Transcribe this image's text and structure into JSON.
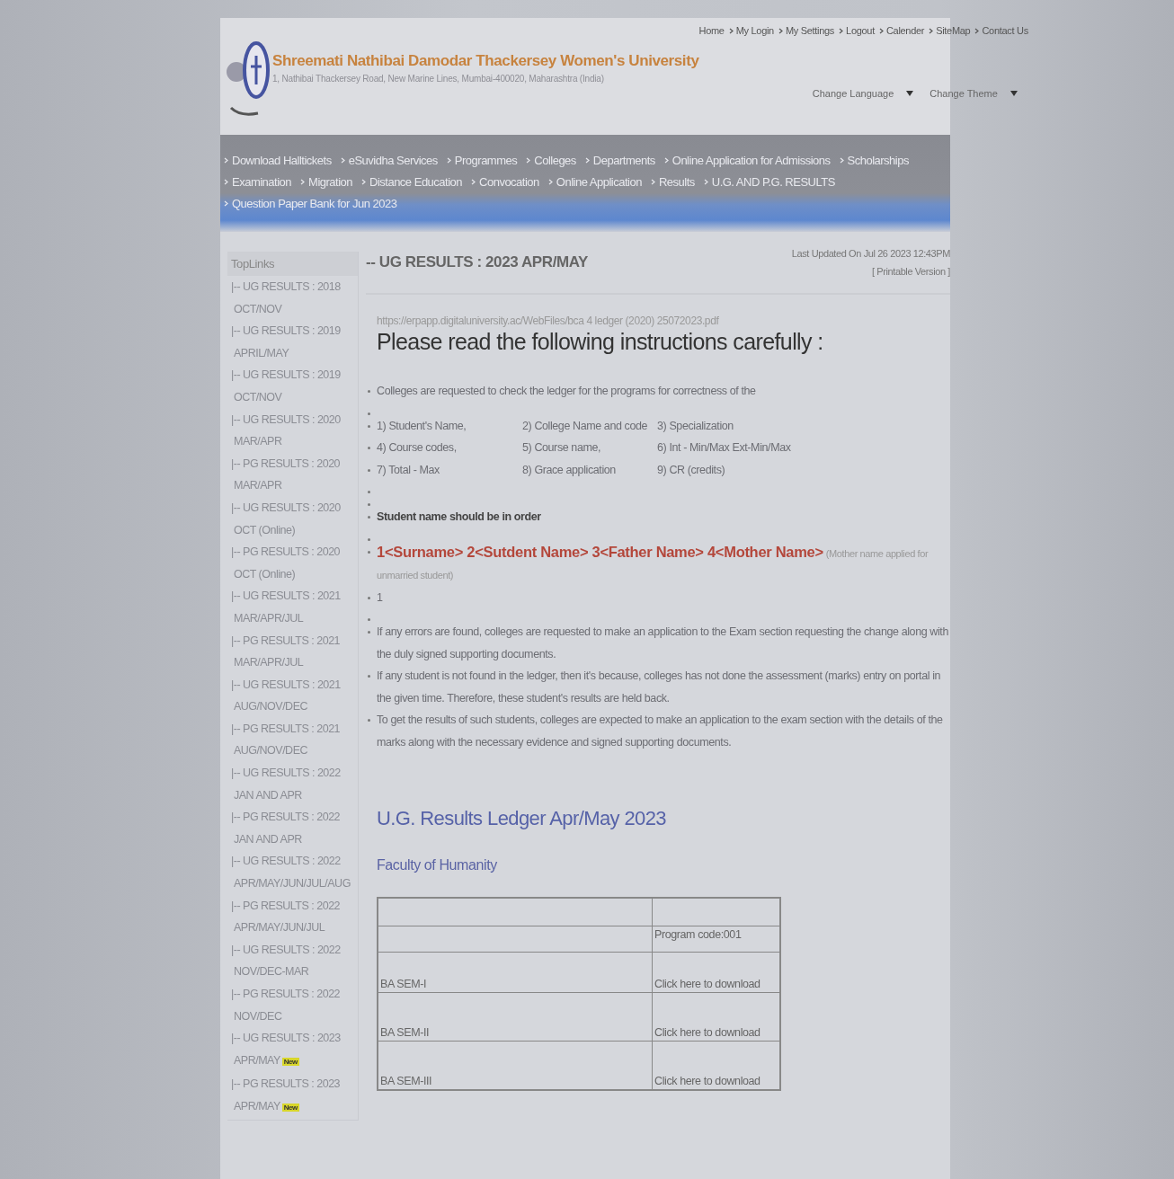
{
  "header": {
    "university_name": "Shreemati Nathibai Damodar Thackersey Women's University",
    "address": "1, Nathibai Thackersey Road, New Marine Lines, Mumbai-400020, Maharashtra (India)",
    "top_links": [
      "Home",
      "My Login",
      "My Settings",
      "Logout",
      "Calender",
      "SiteMap",
      "Contact Us"
    ],
    "selects": [
      "Change Language",
      "Change Theme"
    ]
  },
  "main_menu": [
    "Download Halltickets",
    "eSuvidha Services",
    "Programmes",
    "Colleges",
    "Departments",
    "Online Application for Admissions",
    "Scholarships",
    "Examination",
    "Migration",
    "Distance Education",
    "Convocation",
    "Online Application",
    "Results",
    "U.G. AND P.G. RESULTS",
    "Question Paper Bank for Jun 2023"
  ],
  "sidebar": {
    "title": "TopLinks",
    "items": [
      {
        "title": "|-- UG RESULTS : 2018",
        "period": "OCT/NOV"
      },
      {
        "title": "|-- UG RESULTS : 2019",
        "period": "APRIL/MAY"
      },
      {
        "title": "|-- UG RESULTS : 2019",
        "period": "OCT/NOV"
      },
      {
        "title": "|-- UG RESULTS : 2020",
        "period": "MAR/APR"
      },
      {
        "title": "|-- PG RESULTS : 2020",
        "period": "MAR/APR"
      },
      {
        "title": "|-- UG RESULTS : 2020",
        "period": "OCT (Online)"
      },
      {
        "title": "|-- PG RESULTS : 2020",
        "period": "OCT (Online)"
      },
      {
        "title": "|-- UG RESULTS : 2021",
        "period": "MAR/APR/JUL"
      },
      {
        "title": "|-- PG RESULTS : 2021",
        "period": "MAR/APR/JUL"
      },
      {
        "title": "|-- UG RESULTS : 2021",
        "period": "AUG/NOV/DEC"
      },
      {
        "title": "|-- PG RESULTS : 2021",
        "period": "AUG/NOV/DEC"
      },
      {
        "title": "|-- UG RESULTS : 2022",
        "period": "JAN AND APR"
      },
      {
        "title": "|-- PG RESULTS : 2022",
        "period": "JAN AND APR"
      },
      {
        "title": "|-- UG RESULTS : 2022",
        "period": "APR/MAY/JUN/JUL/AUG"
      },
      {
        "title": "|-- PG RESULTS : 2022",
        "period": "APR/MAY/JUN/JUL"
      },
      {
        "title": "|-- UG RESULTS : 2022",
        "period": "NOV/DEC-MAR"
      },
      {
        "title": "|-- PG RESULTS : 2022",
        "period": "NOV/DEC"
      },
      {
        "title": "|-- UG RESULTS : 2023",
        "period": "APR/MAY",
        "badge": "New"
      },
      {
        "title": "|-- PG RESULTS : 2023",
        "period": "APR/MAY",
        "badge": "New"
      }
    ]
  },
  "content": {
    "title": "-- UG RESULTS : 2023 APR/MAY",
    "last_updated": "Last Updated On Jul 26 2023 12:43PM",
    "printable": "[ Printable Version ]",
    "url": "https://erpapp.digitaluniversity.ac/WebFiles/bca 4 ledger (2020) 25072023.pdf",
    "heading": "Please read the following instructions carefully :",
    "instructions": [
      {
        "kind": "text",
        "text": "Colleges are requested to check the ledger for the  programs for correctness of the"
      },
      {
        "kind": "blank"
      },
      {
        "kind": "fields",
        "cells": [
          "1) Student's Name,",
          "2) College Name and code",
          "3) Specialization"
        ]
      },
      {
        "kind": "fields",
        "cells": [
          "4) Course codes,",
          "5) Course name,",
          "6) Int - Min/Max Ext-Min/Max"
        ]
      },
      {
        "kind": "fields",
        "cells": [
          "7) Total - Max",
          "8) Grace application",
          "9) CR (credits)"
        ]
      },
      {
        "kind": "blank"
      },
      {
        "kind": "blank"
      },
      {
        "kind": "bold",
        "text": "Student name should be in order"
      },
      {
        "kind": "blank"
      },
      {
        "kind": "names",
        "text": "1<Surname> 2<Sutdent Name> 3<Father Name> 4<Mother Name>",
        "note": "(Mother name applied for unmarried student)"
      },
      {
        "kind": "text",
        "text": "1"
      },
      {
        "kind": "blank"
      },
      {
        "kind": "text",
        "text": "If any errors are found, colleges are requested to make an application to the Exam section requesting the change along with the duly signed supporting documents."
      },
      {
        "kind": "text",
        "text": "If any student is not found in the ledger, then it's because, colleges has not done the assessment (marks) entry on portal in the given time. Therefore, these student's results are held back."
      },
      {
        "kind": "text",
        "text": "To get the results of such students, colleges are expected to make an application to the exam section with the details of the marks along with the necessary evidence and signed supporting documents."
      }
    ],
    "ledger_title": "U.G. Results Ledger Apr/May 2023",
    "faculty": "Faculty of Humanity",
    "table": {
      "program_code": "Program code:001",
      "rows": [
        {
          "semester": "BA SEM-I",
          "link": "Click here to download"
        },
        {
          "semester": "BA SEM-II",
          "link": "Click here to download"
        },
        {
          "semester": "BA SEM-III",
          "link": "Click here to download"
        }
      ]
    }
  }
}
